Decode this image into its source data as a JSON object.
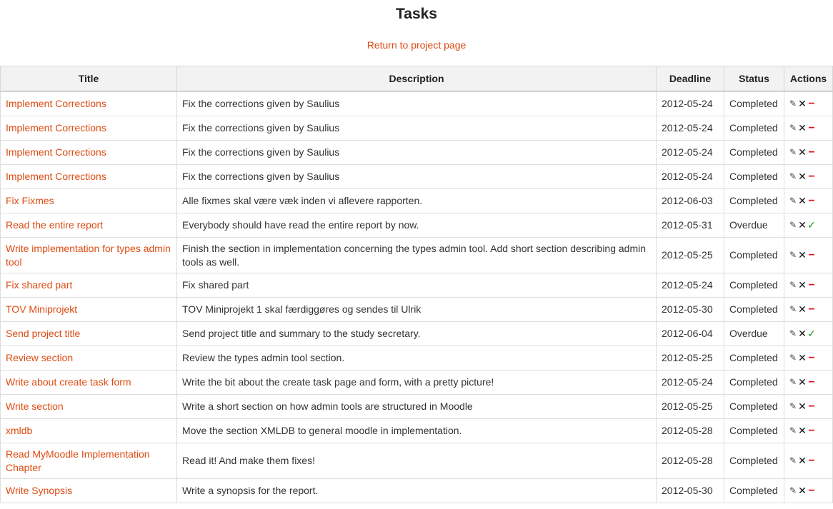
{
  "page": {
    "title": "Tasks",
    "return_link": "Return to project page"
  },
  "table": {
    "headers": {
      "title": "Title",
      "description": "Description",
      "deadline": "Deadline",
      "status": "Status",
      "actions": "Actions"
    },
    "rows": [
      {
        "title": "Implement Corrections",
        "description": "Fix the corrections given by Saulius",
        "deadline": "2012-05-24",
        "status": "Completed",
        "third_action": "remove-icon"
      },
      {
        "title": "Implement Corrections",
        "description": "Fix the corrections given by Saulius",
        "deadline": "2012-05-24",
        "status": "Completed",
        "third_action": "remove-icon"
      },
      {
        "title": "Implement Corrections",
        "description": "Fix the corrections given by Saulius",
        "deadline": "2012-05-24",
        "status": "Completed",
        "third_action": "remove-icon"
      },
      {
        "title": "Implement Corrections",
        "description": "Fix the corrections given by Saulius",
        "deadline": "2012-05-24",
        "status": "Completed",
        "third_action": "remove-icon"
      },
      {
        "title": "Fix Fixmes",
        "description": "Alle fixmes skal være væk inden vi aflevere rapporten.",
        "deadline": "2012-06-03",
        "status": "Completed",
        "third_action": "remove-icon"
      },
      {
        "title": "Read the entire report",
        "description": "Everybody should have read the entire report by now.",
        "deadline": "2012-05-31",
        "status": "Overdue",
        "third_action": "check-icon"
      },
      {
        "title": "Write implementation for types admin tool",
        "description": "Finish the section in implementation concerning the types admin tool. Add short section describing admin tools as well.",
        "deadline": "2012-05-25",
        "status": "Completed",
        "third_action": "remove-icon"
      },
      {
        "title": "Fix shared part",
        "description": "Fix shared part",
        "deadline": "2012-05-24",
        "status": "Completed",
        "third_action": "remove-icon"
      },
      {
        "title": "TOV Miniprojekt",
        "description": "TOV Miniprojekt 1 skal færdiggøres og sendes til Ulrik",
        "deadline": "2012-05-30",
        "status": "Completed",
        "third_action": "remove-icon"
      },
      {
        "title": "Send project title",
        "description": "Send project title and summary to the study secretary.",
        "deadline": "2012-06-04",
        "status": "Overdue",
        "third_action": "check-icon"
      },
      {
        "title": "Review section",
        "description": "Review the types admin tool section.",
        "deadline": "2012-05-25",
        "status": "Completed",
        "third_action": "remove-icon"
      },
      {
        "title": "Write about create task form",
        "description": "Write the bit about the create task page and form, with a pretty picture!",
        "deadline": "2012-05-24",
        "status": "Completed",
        "third_action": "remove-icon"
      },
      {
        "title": "Write section",
        "description": "Write a short section on how admin tools are structured in Moodle",
        "deadline": "2012-05-25",
        "status": "Completed",
        "third_action": "remove-icon"
      },
      {
        "title": "xmldb",
        "description": "Move the section XMLDB to general moodle in implementation.",
        "deadline": "2012-05-28",
        "status": "Completed",
        "third_action": "remove-icon"
      },
      {
        "title": "Read MyMoodle Implementation Chapter",
        "description": "Read it! And make them fixes!",
        "deadline": "2012-05-28",
        "status": "Completed",
        "third_action": "remove-icon"
      },
      {
        "title": "Write Synopsis",
        "description": "Write a synopsis for the report.",
        "deadline": "2012-05-30",
        "status": "Completed",
        "third_action": "remove-icon"
      }
    ]
  },
  "colors": {
    "link": "#dd4b12",
    "header_bg": "#f2f2f2",
    "remove": "#e0141e",
    "check": "#1a9a1a"
  }
}
